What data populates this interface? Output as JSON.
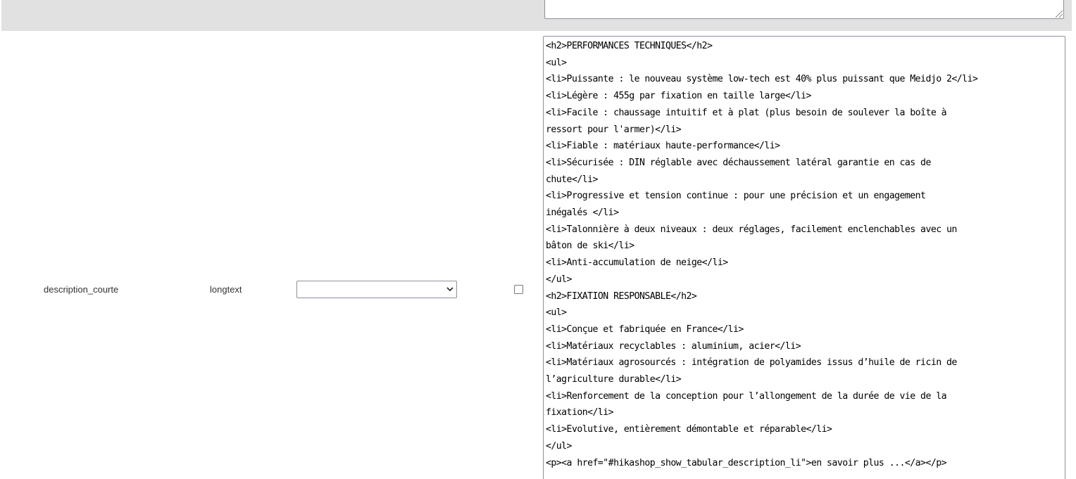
{
  "field": {
    "name": "description_courte",
    "type": "longtext",
    "select_value": ""
  },
  "content_lines": [
    "<h2>PERFORMANCES TECHNIQUES</h2>",
    "<ul>",
    "<li>Puissante : le nouveau système low-tech est 40% plus puissant que Meidjo 2</li>",
    "<li>Légère : 455g par fixation en taille large</li>",
    "<li>Facile : chaussage intuitif et à plat (plus besoin de soulever la boîte à",
    "ressort pour l'armer)</li>",
    "<li>Fiable : matériaux haute-performance</li>",
    "<li>Sécurisée : DIN réglable avec déchaussement latéral garantie en cas de",
    "chute</li>",
    "<li>Progressive et tension continue : pour une précision et un engagement",
    "inégalés </li>",
    "<li>Talonnière à deux niveaux : deux réglages, facilement enclenchables avec un",
    "bâton de ski</li>",
    "<li>Anti-accumulation de neige</li>",
    "</ul>",
    "<h2>FIXATION RESPONSABLE</h2>",
    "<ul>",
    "<li>Conçue et fabriquée en France</li>",
    "<li>Matériaux recyclables : aluminium, acier</li>",
    "<li>Matériaux agrosourcés : intégration de polyamides issus d’huile de ricin de",
    "l’agriculture durable</li>",
    "<li>Renforcement de la conception pour l’allongement de la durée de vie de la",
    "fixation</li>",
    "<li>Evolutive, entièrement démontable et réparable</li>",
    "</ul>",
    "<p><a href=\"#hikashop_show_tabular_description_li\">en savoir plus ...</a></p>"
  ]
}
